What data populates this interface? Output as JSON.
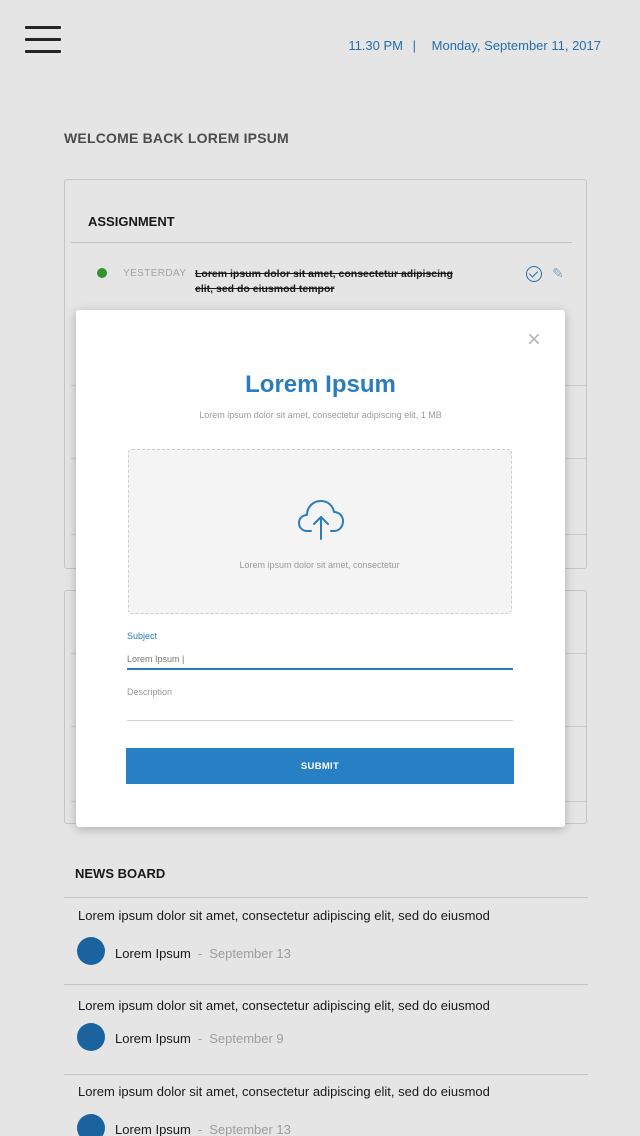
{
  "header": {
    "time": "11.30 PM",
    "separator": "|",
    "date": "Monday, September 11, 2017"
  },
  "welcome": "WELCOME BACK LOREM IPSUM",
  "assignment": {
    "title": "ASSIGNMENT",
    "items": [
      {
        "status_color": "#3aa335",
        "date": "YESTERDAY",
        "text": "Lorem ipsum dolor sit amet, consectetur adipiscing elit, sed do eiusmod tempor",
        "completed": true
      }
    ]
  },
  "news": {
    "title": "NEWS BOARD",
    "items": [
      {
        "text": "Lorem ipsum dolor sit amet, consectetur adipiscing elit, sed do eiusmod",
        "author": "Lorem Ipsum",
        "separator": "-",
        "date": "September 13"
      },
      {
        "text": "Lorem ipsum dolor sit amet, consectetur adipiscing elit, sed do eiusmod",
        "author": "Lorem Ipsum",
        "separator": "-",
        "date": "September 9"
      },
      {
        "text": "Lorem ipsum dolor sit amet, consectetur adipiscing elit, sed do eiusmod",
        "author": "Lorem Ipsum",
        "separator": "-",
        "date": "September 13"
      }
    ]
  },
  "modal": {
    "close": "×",
    "title": "Lorem Ipsum",
    "subtitle": "Lorem ipsum dolor sit amet, consectetur adipiscing elit, 1 MB",
    "dropzone_text": "Lorem ipsum dolor sit amet, consectetur",
    "subject_label": "Subject",
    "subject_value": "Lorem Ipsum |",
    "description_label": "Description",
    "description_value": "",
    "submit_label": "SUBMIT"
  },
  "colors": {
    "accent": "#2b7bbf",
    "button": "#2780c4",
    "avatar": "#1f6fb1",
    "status_green": "#3aa335"
  },
  "icons": [
    "menu-icon",
    "check-circle-icon",
    "edit-icon",
    "close-icon",
    "cloud-upload-icon"
  ]
}
